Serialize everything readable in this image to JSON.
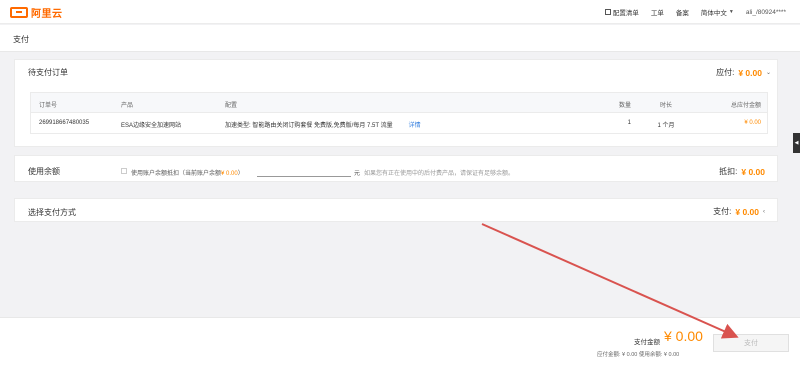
{
  "brand": {
    "name": "阿里云",
    "accent": "#ff6a00"
  },
  "topnav": {
    "config_list": "配置清单",
    "ticket": "工单",
    "filing": "备案",
    "language": "简体中文",
    "account": "ali_/80924****"
  },
  "page": {
    "title": "支付"
  },
  "order_panel": {
    "title": "待支付订单",
    "due_label": "应付:",
    "due_amount": "¥ 0.00",
    "columns": [
      "订单号",
      "产品",
      "配置",
      "数量",
      "时长",
      "总应付金额"
    ],
    "rows": [
      {
        "order_id": "269918667480035",
        "product": "ESA边缘安全加速网站",
        "config": "加速类型: 智能路由关闭订购套餐 免费版,免费版/每月 7.5T 流量",
        "detail": "详情",
        "quantity": "1",
        "duration": "1 个月",
        "amount": "¥ 0.00"
      }
    ]
  },
  "balance_panel": {
    "title": "使用余额",
    "label_prefix": "使用账户余额抵扣（当前账户余额",
    "balance": "¥ 0.00",
    "label_suffix": "）",
    "input_value": "",
    "unit": "元",
    "hint": "如果您有正在使用中的后付费产品，请保证有足够余额。",
    "deduct_label": "抵扣:",
    "deduct_amount": "¥ 0.00"
  },
  "paymethod_panel": {
    "title": "选择支付方式",
    "label": "支付:",
    "amount": "¥ 0.00"
  },
  "footer": {
    "pay_label": "支付金额",
    "pay_total": "¥ 0.00",
    "sub_due": "应付金额: ¥ 0.00  使用余额: ¥ 0.00",
    "pay_button": "支付"
  },
  "colors": {
    "amount": "#ff8a00",
    "arrow": "#d9534f"
  }
}
